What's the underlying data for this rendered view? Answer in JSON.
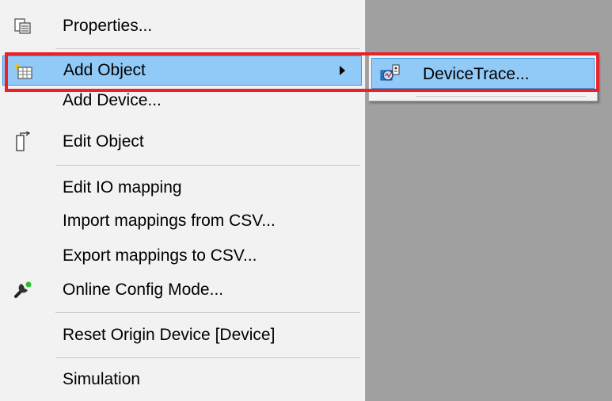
{
  "context_menu": {
    "items": [
      {
        "label": "Properties...",
        "icon": "properties-icon"
      },
      {
        "label": "Add Object",
        "icon": "add-object-icon",
        "has_submenu": true,
        "highlighted": true
      },
      {
        "label": "Add Device...",
        "icon": ""
      },
      {
        "label": "Edit Object",
        "icon": "edit-object-icon"
      },
      {
        "label": "Edit IO mapping",
        "icon": ""
      },
      {
        "label": "Import mappings from CSV...",
        "icon": ""
      },
      {
        "label": "Export mappings to CSV...",
        "icon": ""
      },
      {
        "label": "Online Config Mode...",
        "icon": "online-config-icon"
      },
      {
        "label": "Reset Origin Device [Device]",
        "icon": ""
      },
      {
        "label": "Simulation",
        "icon": ""
      }
    ]
  },
  "submenu": {
    "items": [
      {
        "label": "DeviceTrace...",
        "icon": "devicetrace-icon",
        "highlighted": true
      }
    ]
  },
  "colors": {
    "highlight": "#91c9f7",
    "highlight_border": "#3d96e0",
    "annotation_box": "#e8222a",
    "menu_bg": "#f2f2f2",
    "background": "#a0a0a0"
  }
}
